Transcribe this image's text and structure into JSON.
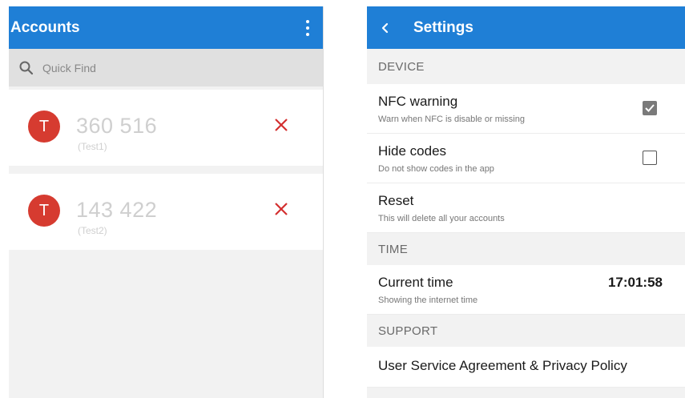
{
  "accounts_screen": {
    "title": "Accounts",
    "search_placeholder": "Quick Find",
    "accounts": [
      {
        "initial": "T",
        "code": "360 516",
        "name": "(Test1)"
      },
      {
        "initial": "T",
        "code": "143 422",
        "name": "(Test2)"
      }
    ]
  },
  "settings_screen": {
    "title": "Settings",
    "device_header": "DEVICE",
    "nfc_title": "NFC warning",
    "nfc_sub": "Warn when NFC is disable or missing",
    "nfc_checked": true,
    "hide_title": "Hide codes",
    "hide_sub": "Do not show codes in the app",
    "hide_checked": false,
    "reset_title": "Reset",
    "reset_sub": "This will delete all your accounts",
    "time_header": "TIME",
    "time_title": "Current time",
    "time_sub": "Showing the internet time",
    "time_value": "17:01:58",
    "support_header": "SUPPORT",
    "policy_title": "User Service Agreement & Privacy Policy"
  },
  "colors": {
    "appbar": "#1f7fd6",
    "avatar": "#d63b30",
    "delete": "#d32f2f"
  },
  "icons": {
    "menu": "kebab-menu-icon",
    "search": "search-icon",
    "delete": "close-icon",
    "back": "chevron-left-icon",
    "checkbox": "checkbox-icon"
  }
}
